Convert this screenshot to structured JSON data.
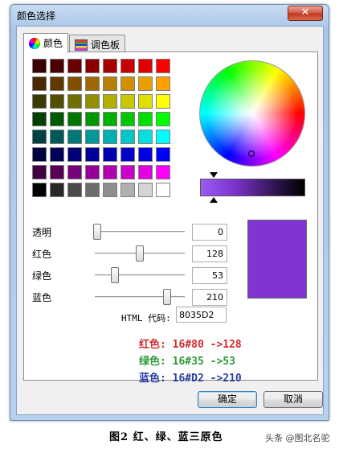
{
  "window": {
    "title": "颜色选择",
    "close_symbol": "✕"
  },
  "tabs": [
    {
      "label": "颜色",
      "icon": "color-wheel-icon"
    },
    {
      "label": "调色板",
      "icon": "palette-icon"
    }
  ],
  "swatches": [
    [
      "#3a0000",
      "#4a0000",
      "#6a0000",
      "#8a0000",
      "#a80000",
      "#c80000",
      "#e00000",
      "#ff0000"
    ],
    [
      "#4a2800",
      "#603800",
      "#805000",
      "#a06800",
      "#b88000",
      "#d09000",
      "#e8a000",
      "#ffa000"
    ],
    [
      "#3a3a00",
      "#505000",
      "#707000",
      "#909000",
      "#b0b000",
      "#c8c800",
      "#e0e000",
      "#ffff00"
    ],
    [
      "#004000",
      "#005800",
      "#007800",
      "#009800",
      "#00b000",
      "#00c800",
      "#00e000",
      "#00ff00"
    ],
    [
      "#004040",
      "#005858",
      "#007878",
      "#009898",
      "#00b0b0",
      "#00c8c8",
      "#00e0e0",
      "#00ffff"
    ],
    [
      "#000040",
      "#000058",
      "#000078",
      "#000098",
      "#0000b0",
      "#0000c8",
      "#0000e0",
      "#0000ff"
    ],
    [
      "#400040",
      "#580058",
      "#780078",
      "#980098",
      "#b000b0",
      "#c800c8",
      "#e000e0",
      "#ff00ff"
    ],
    [
      "#000000",
      "#282828",
      "#4a4a4a",
      "#6c6c6c",
      "#8e8e8e",
      "#b0b0b0",
      "#d4d4d4",
      "#ffffff"
    ]
  ],
  "sliders": [
    {
      "label": "透明",
      "value": "0",
      "fraction": 0.0
    },
    {
      "label": "红色",
      "value": "128",
      "fraction": 0.502
    },
    {
      "label": "绿色",
      "value": "53",
      "fraction": 0.208
    },
    {
      "label": "蓝色",
      "value": "210",
      "fraction": 0.824
    }
  ],
  "selected_color": "#8035D2",
  "html_code": {
    "label": "HTML 代码:",
    "value": "8035D2"
  },
  "annotations": [
    {
      "text": "红色: 16#80 ->128",
      "color": "#d42a2a"
    },
    {
      "text": "绿色: 16#35 ->53",
      "color": "#2e9a3a"
    },
    {
      "text": "蓝色: 16#D2 ->210",
      "color": "#2c3fa0"
    }
  ],
  "buttons": {
    "ok": "确定",
    "cancel": "取消"
  },
  "caption": "图2 红、绿、蓝三原色",
  "watermark": "头条 @图北名驼"
}
